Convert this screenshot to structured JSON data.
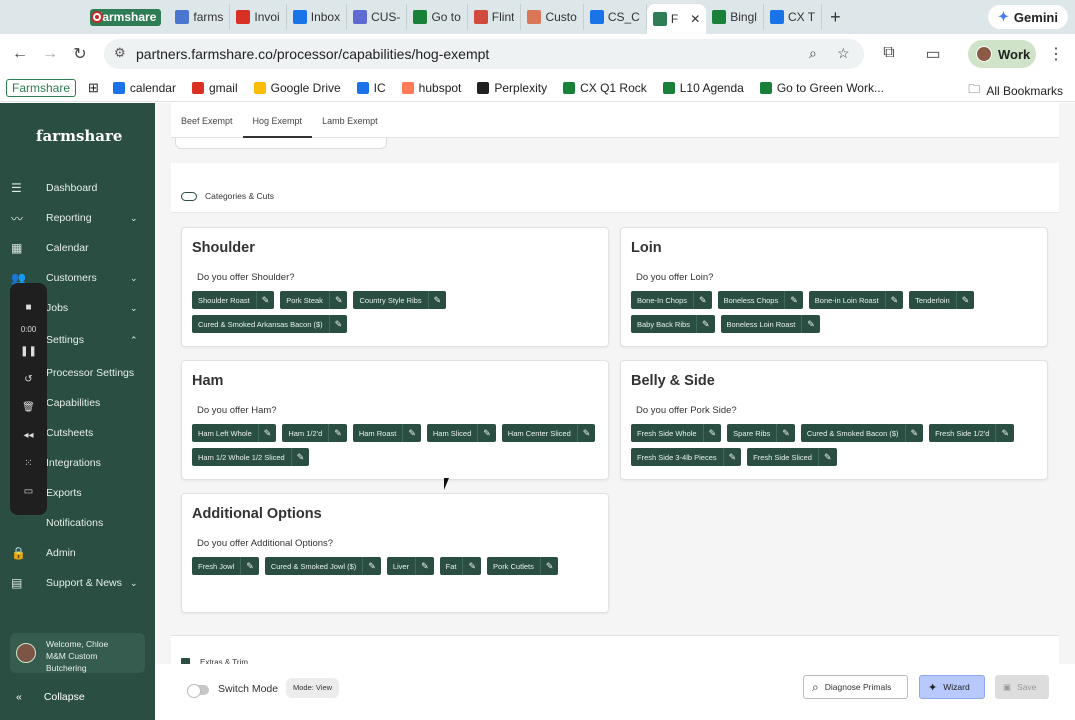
{
  "browser": {
    "tabs": [
      {
        "label": "Farmshare",
        "icon": "farmshare-icon"
      },
      {
        "label": "farms",
        "icon": "doc-icon",
        "color": "#4a76d0"
      },
      {
        "label": "Invoi",
        "icon": "gmail-icon",
        "color": "#d93025"
      },
      {
        "label": "Inbox",
        "icon": "inbox-icon",
        "color": "#1a73e8"
      },
      {
        "label": "CUS-",
        "icon": "linear-icon",
        "color": "#5e6ad2"
      },
      {
        "label": "Go to",
        "icon": "sheets-icon",
        "color": "#188038"
      },
      {
        "label": "Flint",
        "icon": "flint-icon",
        "color": "#d14a3b"
      },
      {
        "label": "Custo",
        "icon": "claude-icon",
        "color": "#d97757"
      },
      {
        "label": "CS_C",
        "icon": "docs-icon",
        "color": "#1a73e8"
      },
      {
        "label": "F",
        "icon": "farmshare-leaf-icon",
        "color": "#2e7d55"
      },
      {
        "label": "Bingl",
        "icon": "sheets-icon",
        "color": "#188038"
      },
      {
        "label": "CX T",
        "icon": "docs-icon",
        "color": "#1a73e8"
      }
    ],
    "gemini_label": "Gemini",
    "url_host": "partners.farmshare.co",
    "url_path": "/processor/capabilities/hog-exempt",
    "profile_label": "Work",
    "bookmarks": [
      {
        "label": "calendar",
        "color": "#1a73e8"
      },
      {
        "label": "gmail",
        "color": "#d93025"
      },
      {
        "label": "Google Drive",
        "color": "#fbbc04"
      },
      {
        "label": "IC",
        "color": "#1a73e8"
      },
      {
        "label": "hubspot",
        "color": "#ff7a59"
      },
      {
        "label": "Perplexity",
        "color": "#222222"
      },
      {
        "label": "CX Q1 Rock",
        "color": "#188038"
      },
      {
        "label": "L10 Agenda",
        "color": "#188038"
      },
      {
        "label": "Go to Green Work...",
        "color": "#188038"
      }
    ],
    "farmshare_bookmark": "Farmshare",
    "all_bookmarks": "All Bookmarks"
  },
  "sidebar": {
    "logo": "farmshare",
    "items": [
      {
        "label": "Dashboard",
        "icon": "list-icon"
      },
      {
        "label": "Reporting",
        "icon": "trend-icon",
        "chevron": "⌄"
      },
      {
        "label": "Calendar",
        "icon": "calendar-icon"
      },
      {
        "label": "Customers",
        "icon": "users-icon",
        "chevron": "⌄"
      },
      {
        "label": "Jobs",
        "icon": "briefcase-icon",
        "chevron": "⌄"
      },
      {
        "label": "Settings",
        "icon": "gear-icon",
        "chevron": "⌃"
      },
      {
        "label": "Processor Settings"
      },
      {
        "label": "Capabilities"
      },
      {
        "label": "Cutsheets"
      },
      {
        "label": "Integrations"
      },
      {
        "label": "Exports"
      },
      {
        "label": "Notifications"
      },
      {
        "label": "Admin",
        "icon": "lock-icon"
      },
      {
        "label": "Support & News",
        "icon": "chat-icon",
        "chevron": "⌄"
      }
    ],
    "recorder_time": "0:00",
    "welcome_line1": "Welcome, Chloe",
    "welcome_line2": "M&M Custom",
    "welcome_line3": "Butchering",
    "collapse_label": "Collapse"
  },
  "page": {
    "tabs": [
      "Beef Exempt",
      "Hog Exempt",
      "Lamb Exempt"
    ],
    "active_tab": "Hog Exempt",
    "section_title": "Categories & Cuts",
    "cards": [
      {
        "title": "Shoulder",
        "question": "Do you offer Shoulder?",
        "chips": [
          "Shoulder Roast",
          "Pork Steak",
          "Country Style Ribs",
          "Cured & Smoked Arkansas Bacon ($)"
        ]
      },
      {
        "title": "Loin",
        "question": "Do you offer Loin?",
        "chips": [
          "Bone-In Chops",
          "Boneless Chops",
          "Bone-in Loin Roast",
          "Tenderloin",
          "Baby Back Ribs",
          "Boneless Loin Roast"
        ]
      },
      {
        "title": "Ham",
        "question": "Do you offer Ham?",
        "chips": [
          "Ham Left Whole",
          "Ham 1/2'd",
          "Ham Roast",
          "Ham Sliced",
          "Ham Center Sliced",
          "Ham 1/2 Whole 1/2 Sliced"
        ]
      },
      {
        "title": "Belly & Side",
        "question": "Do you offer Pork Side?",
        "chips": [
          "Fresh Side Whole",
          "Spare Ribs",
          "Cured & Smoked Bacon ($)",
          "Fresh Side 1/2'd",
          "Fresh Side 3-4lb Pieces",
          "Fresh Side Sliced"
        ]
      },
      {
        "title": "Additional Options",
        "question": "Do you offer Additional Options?",
        "chips": [
          "Fresh Jowl",
          "Cured & Smoked Jowl ($)",
          "Liver",
          "Fat",
          "Pork Cutlets"
        ]
      }
    ],
    "extras_title": "Extras & Trim",
    "switch_mode_label": "Switch Mode",
    "mode_label": "Mode: View",
    "diagnose_label": "Diagnose Primals",
    "wizard_label": "Wizard",
    "save_label": "Save"
  },
  "colors": {
    "sidebar": "#2a4e42",
    "chip": "#2a4e42",
    "wizard": "#b7c9ff"
  }
}
